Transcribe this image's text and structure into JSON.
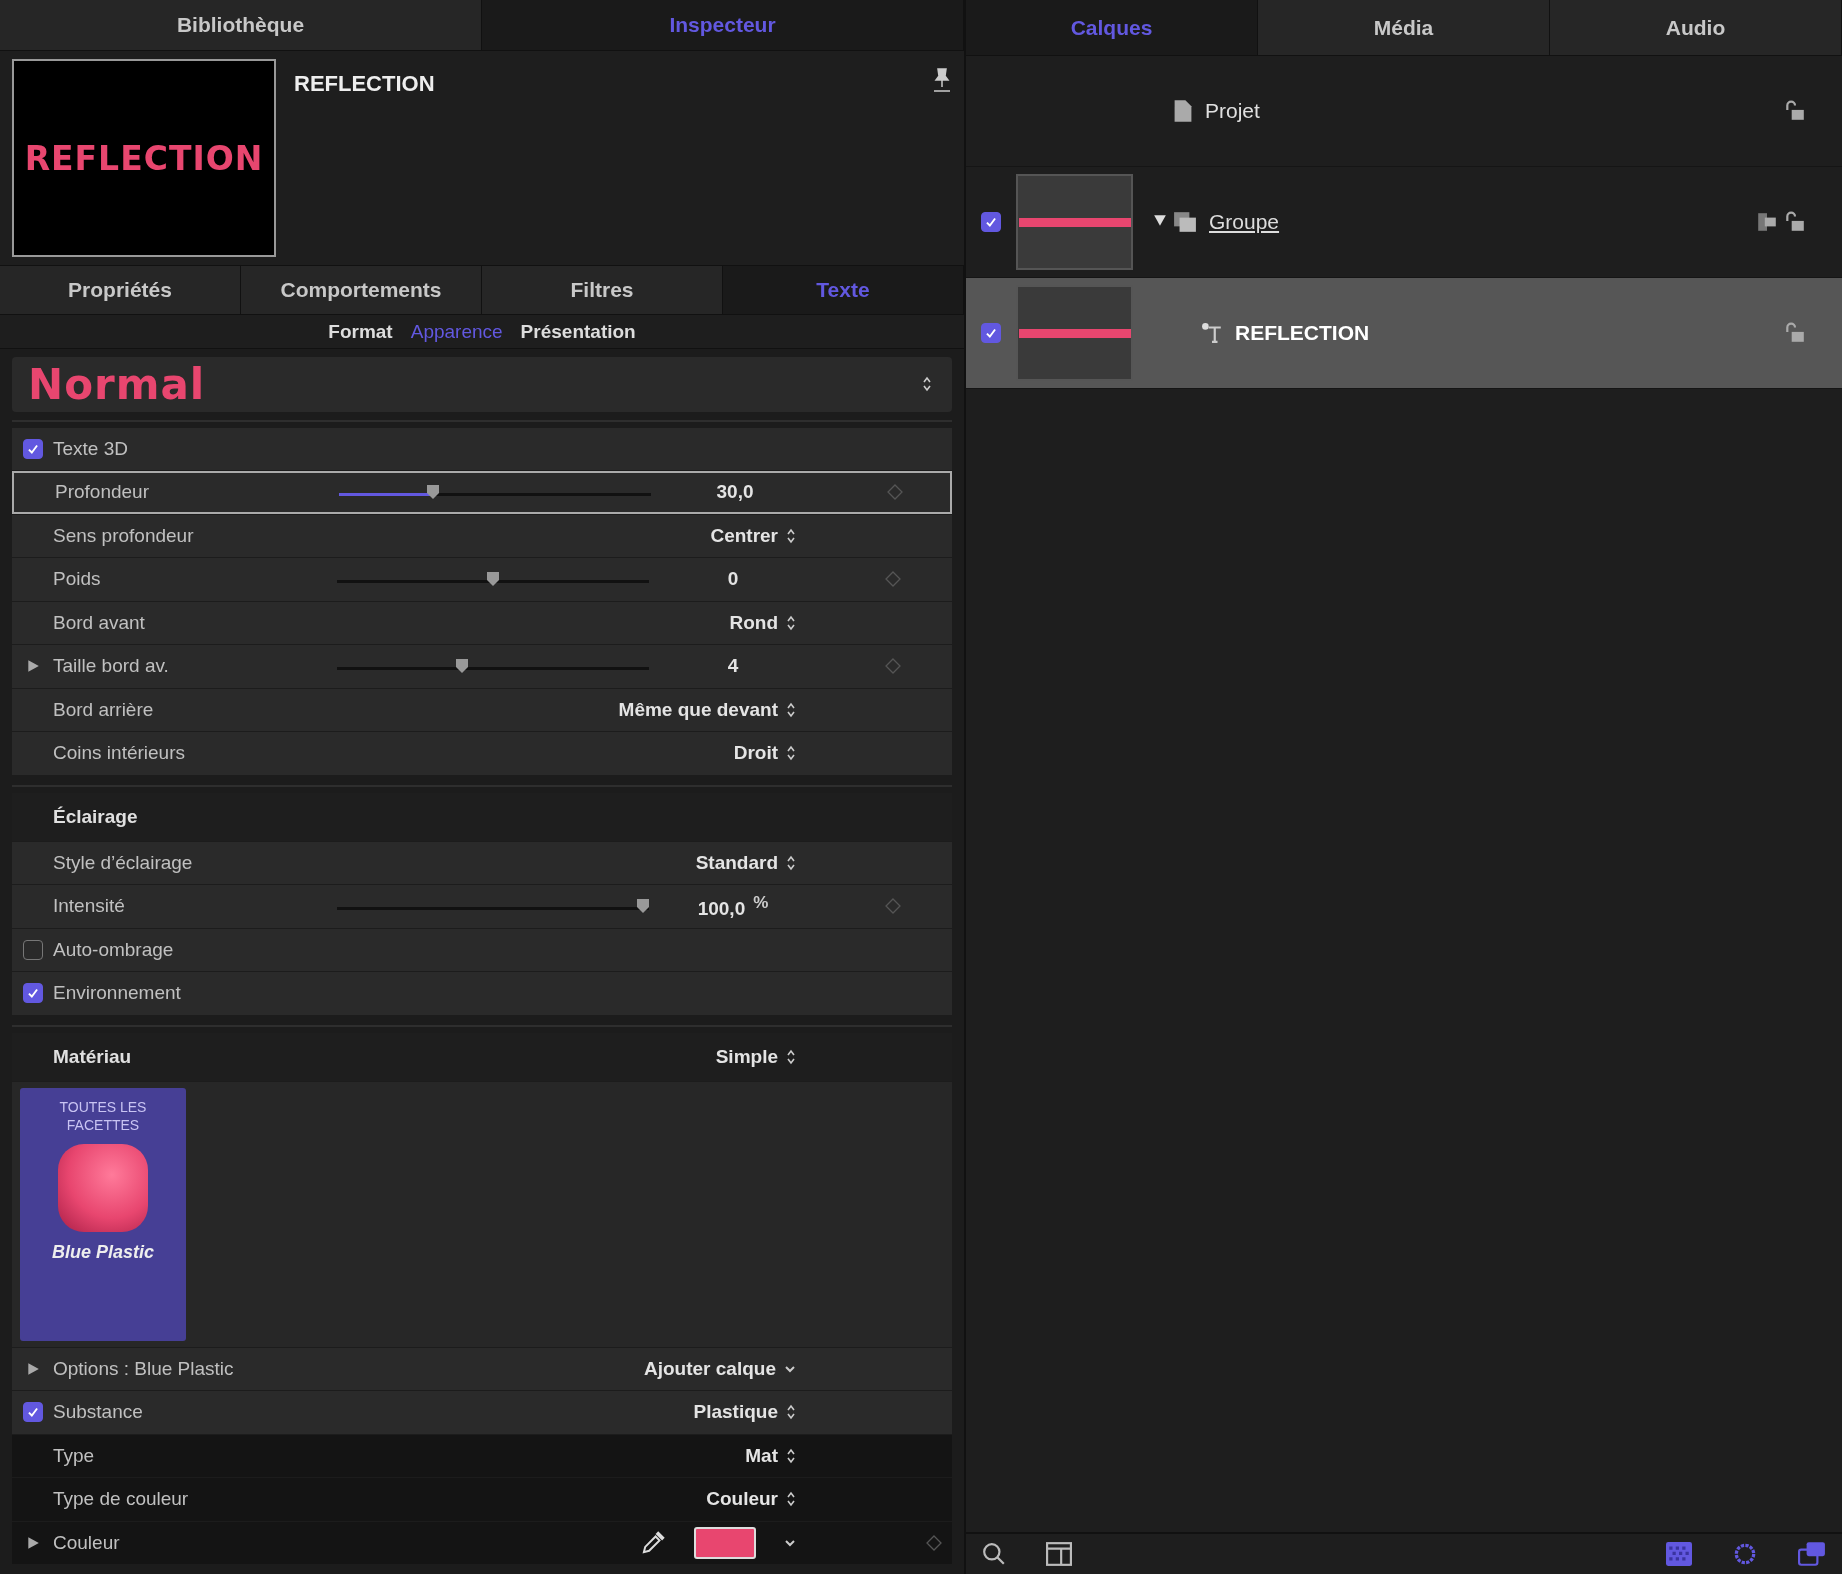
{
  "left_tabs": [
    {
      "label": "Bibliothèque",
      "selected": false
    },
    {
      "label": "Inspecteur",
      "selected": true
    }
  ],
  "inspector": {
    "preview_text": "REFLECTION",
    "title": "REFLECTION",
    "tabs": [
      {
        "label": "Propriétés",
        "selected": false
      },
      {
        "label": "Comportements",
        "selected": false
      },
      {
        "label": "Filtres",
        "selected": false
      },
      {
        "label": "Texte",
        "selected": true
      }
    ],
    "subtabs": [
      {
        "label": "Format",
        "selected": false
      },
      {
        "label": "Apparence",
        "selected": true
      },
      {
        "label": "Présentation",
        "selected": false
      }
    ],
    "preset": "Normal",
    "groups": [
      {
        "rows": [
          {
            "kind": "checkbox",
            "label": "Texte 3D",
            "checked": true
          },
          {
            "kind": "slider",
            "label": "Profondeur",
            "level": 0.3,
            "value": "30,0",
            "focused": true
          },
          {
            "kind": "popup",
            "label": "Sens profondeur",
            "value": "Centrer"
          },
          {
            "kind": "slider",
            "label": "Poids",
            "level": 0.5,
            "value": "0",
            "focused": false
          },
          {
            "kind": "popup",
            "label": "Bord avant",
            "value": "Rond"
          },
          {
            "kind": "slider",
            "label": "Taille bord av.",
            "level": 0.4,
            "value": "4",
            "focused": false,
            "expandable": true
          },
          {
            "kind": "popup",
            "label": "Bord arrière",
            "value": "Même que devant"
          },
          {
            "kind": "popup",
            "label": "Coins intérieurs",
            "value": "Droit"
          }
        ]
      },
      {
        "rows": [
          {
            "kind": "section",
            "label": "Éclairage"
          },
          {
            "kind": "popup",
            "label": "Style d’éclairage",
            "value": "Standard"
          },
          {
            "kind": "slider",
            "label": "Intensité",
            "level": 0.98,
            "value": "100,0",
            "unit": "%",
            "focused": false
          },
          {
            "kind": "checkbox",
            "label": "Auto-ombrage",
            "checked": false
          },
          {
            "kind": "checkbox",
            "label": "Environnement",
            "checked": true
          }
        ]
      },
      {
        "rows": [
          {
            "kind": "section",
            "label": "Matériau",
            "value": "Simple"
          },
          {
            "kind": "material",
            "caption": "TOUTES LES FACETTES",
            "name": "Blue Plastic"
          },
          {
            "kind": "menu",
            "label": "Options : Blue Plastic",
            "value": "Ajouter calque",
            "expandable": true
          },
          {
            "kind": "checkbox",
            "label": "Substance",
            "checked": true,
            "value": "Plastique"
          },
          {
            "kind": "popup",
            "label": "Type",
            "value": "Mat",
            "dark": true
          },
          {
            "kind": "popup",
            "label": "Type de couleur",
            "value": "Couleur",
            "dark": true
          },
          {
            "kind": "color",
            "label": "Couleur",
            "color": "#e8466f",
            "expandable": true,
            "dark": true
          }
        ]
      }
    ]
  },
  "right_tabs": [
    {
      "label": "Calques",
      "selected": true
    },
    {
      "label": "Média",
      "selected": false
    },
    {
      "label": "Audio",
      "selected": false
    }
  ],
  "layers": [
    {
      "kind": "project",
      "name": "Projet",
      "selected": false
    },
    {
      "kind": "group",
      "name": "Groupe",
      "visible": true,
      "expanded": true,
      "selected": false,
      "children": [
        {
          "kind": "text",
          "name": "REFLECTION",
          "visible": true,
          "selected": true
        }
      ]
    }
  ]
}
